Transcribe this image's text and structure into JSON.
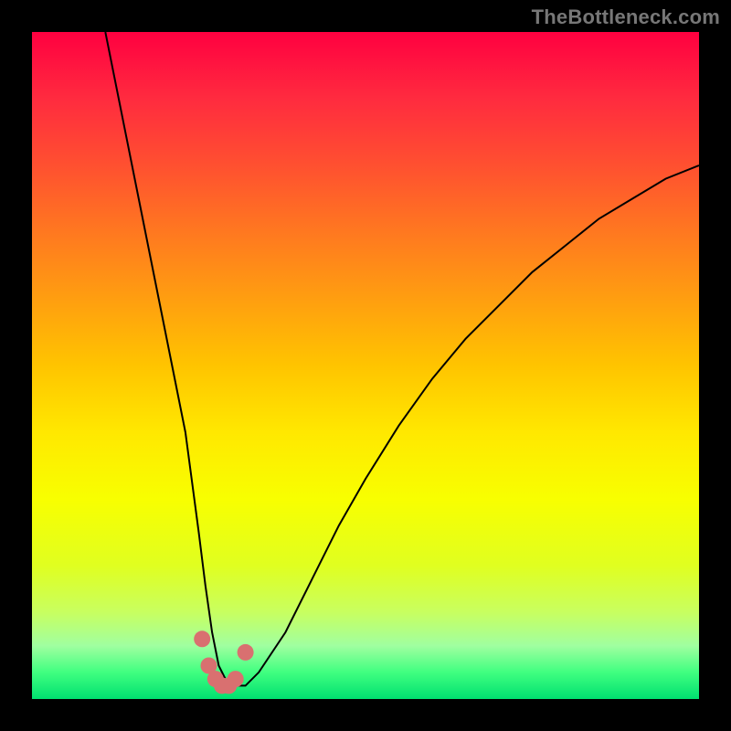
{
  "watermark": "TheBottleneck.com",
  "chart_data": {
    "type": "line",
    "title": "",
    "xlabel": "",
    "ylabel": "",
    "xlim": [
      0,
      100
    ],
    "ylim": [
      0,
      100
    ],
    "series": [
      {
        "name": "curve",
        "x": [
          11,
          13,
          15,
          17,
          19,
          21,
          23,
          25,
          26,
          27,
          28,
          29,
          30,
          32,
          34,
          38,
          42,
          46,
          50,
          55,
          60,
          65,
          70,
          75,
          80,
          85,
          90,
          95,
          100
        ],
        "y": [
          100,
          90,
          80,
          70,
          60,
          50,
          40,
          25,
          17,
          10,
          5,
          3,
          2,
          2,
          4,
          10,
          18,
          26,
          33,
          41,
          48,
          54,
          59,
          64,
          68,
          72,
          75,
          78,
          80
        ]
      }
    ],
    "markers": [
      {
        "x": 25.5,
        "y": 9
      },
      {
        "x": 26.5,
        "y": 5
      },
      {
        "x": 27.5,
        "y": 3
      },
      {
        "x": 28.5,
        "y": 2
      },
      {
        "x": 29.5,
        "y": 2
      },
      {
        "x": 30.5,
        "y": 3
      },
      {
        "x": 32.0,
        "y": 7
      }
    ],
    "background_gradient": {
      "top": "#ff0040",
      "mid": "#ffe800",
      "bottom": "#00e070"
    }
  }
}
